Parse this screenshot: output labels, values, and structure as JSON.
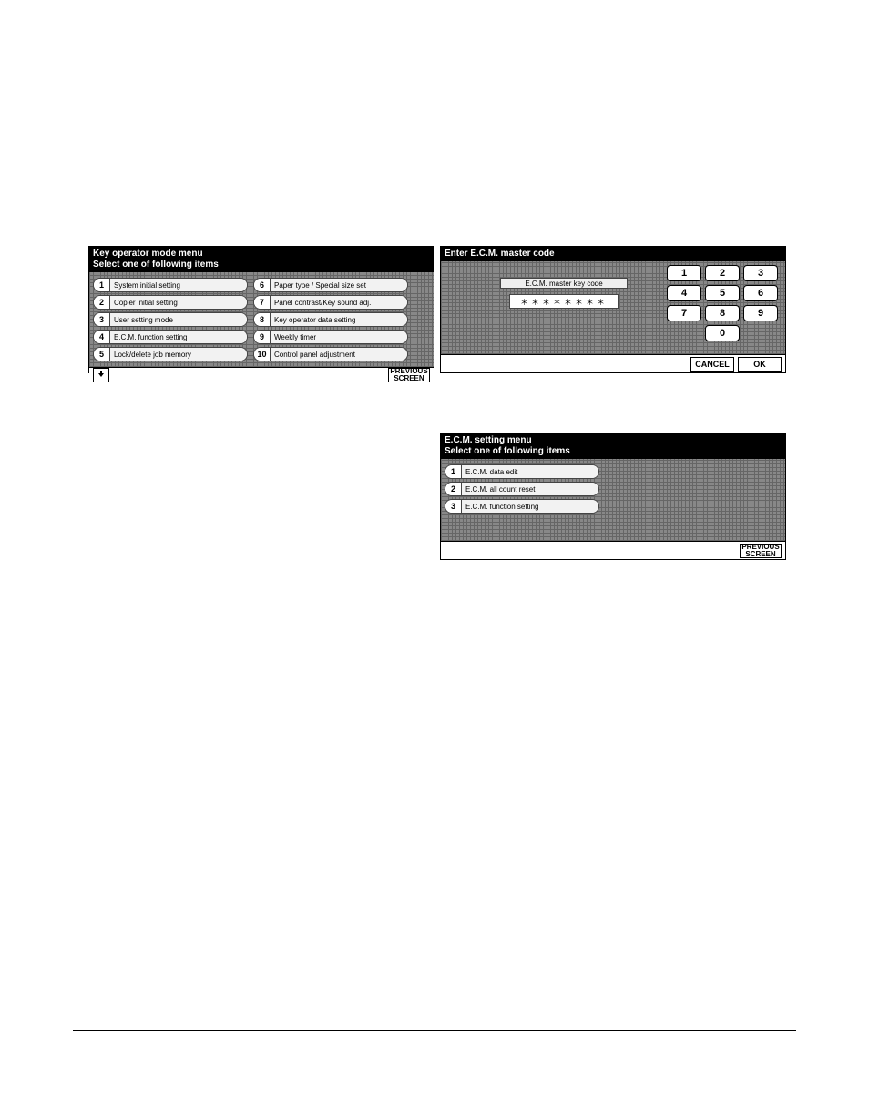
{
  "panel1": {
    "title_line1": "Key operator mode menu",
    "title_line2": "Select one of following items",
    "left": [
      {
        "num": "1",
        "label": "System initial setting"
      },
      {
        "num": "2",
        "label": "Copier initial setting"
      },
      {
        "num": "3",
        "label": "User setting mode"
      },
      {
        "num": "4",
        "label": "E.C.M. function setting"
      },
      {
        "num": "5",
        "label": "Lock/delete job memory"
      }
    ],
    "right": [
      {
        "num": "6",
        "label": "Paper type / Special size set"
      },
      {
        "num": "7",
        "label": "Panel contrast/Key sound adj."
      },
      {
        "num": "8",
        "label": "Key operator data setting"
      },
      {
        "num": "9",
        "label": "Weekly timer"
      },
      {
        "num": "10",
        "label": "Control panel adjustment"
      }
    ],
    "prev1": "PREVIOUS",
    "prev2": "SCREEN"
  },
  "panel2": {
    "title": "Enter E.C.M. master code",
    "code_label": "E.C.M. master key code",
    "code_value": "＊＊＊＊＊＊＊＊",
    "keys": [
      "1",
      "2",
      "3",
      "4",
      "5",
      "6",
      "7",
      "8",
      "9",
      "0"
    ],
    "cancel": "CANCEL",
    "ok": "OK"
  },
  "panel3": {
    "title_line1": "E.C.M. setting menu",
    "title_line2": "Select one of following items",
    "items": [
      {
        "num": "1",
        "label": "E.C.M. data edit"
      },
      {
        "num": "2",
        "label": "E.C.M. all count reset"
      },
      {
        "num": "3",
        "label": "E.C.M. function setting"
      }
    ],
    "prev1": "PREVIOUS",
    "prev2": "SCREEN"
  }
}
